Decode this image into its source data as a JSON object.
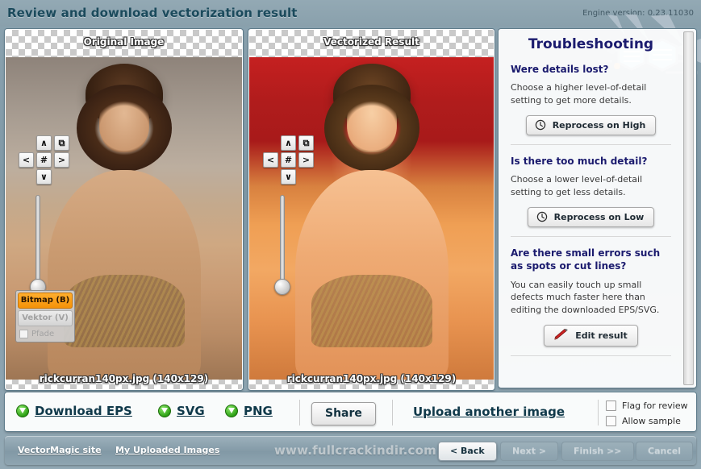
{
  "header": {
    "title": "Review and download vectorization result",
    "engine_version": "Engine version: 0.23.11030"
  },
  "panels": {
    "original": {
      "caption": "Original Image",
      "filename": "rickcurran140px.jpg (140x129)",
      "controls": {
        "up": "∧",
        "down": "∨",
        "left": "<",
        "right": ">",
        "center": "#",
        "fit": "⧉"
      },
      "modes": {
        "bitmap": "Bitmap (B)",
        "vektor": "Vektor (V)",
        "pfade": "Pfade"
      }
    },
    "result": {
      "caption": "Vectorized Result",
      "filename": "rickcurran140px.jpg (140x129)",
      "controls": {
        "up": "∧",
        "down": "∨",
        "left": "<",
        "right": ">",
        "center": "#",
        "fit": "⧉"
      }
    }
  },
  "troubleshooting": {
    "title": "Troubleshooting",
    "sections": [
      {
        "question": "Were details lost?",
        "body": "Choose a higher level-of-detail setting to get more details.",
        "button": "Reprocess on High",
        "icon": "clock-icon"
      },
      {
        "question": "Is there too much detail?",
        "body": "Choose a lower level-of-detail setting to get less details.",
        "button": "Reprocess on Low",
        "icon": "clock-icon"
      },
      {
        "question": "Are there small errors such as spots or cut lines?",
        "body": "You can easily touch up small defects much faster here than editing the downloaded EPS/SVG.",
        "button": "Edit result",
        "icon": "pencil-icon"
      }
    ]
  },
  "action_bar": {
    "downloads": [
      {
        "label": "Download EPS"
      },
      {
        "label": "SVG"
      },
      {
        "label": "PNG"
      }
    ],
    "share": "Share",
    "upload_another": "Upload another image",
    "checkboxes": [
      {
        "label": "Flag for review",
        "checked": false
      },
      {
        "label": "Allow sample",
        "checked": false
      }
    ]
  },
  "footer": {
    "links": [
      {
        "label": "VectorMagic site"
      },
      {
        "label": "My Uploaded Images"
      }
    ],
    "watermark": "www.fullcrackindir.com",
    "nav": [
      {
        "label": "< Back",
        "enabled": true
      },
      {
        "label": "Next >",
        "enabled": false
      },
      {
        "label": "Finish >>",
        "enabled": false
      },
      {
        "label": "Cancel",
        "enabled": false
      }
    ]
  },
  "colors": {
    "accent_orange": "#f59208",
    "link_dark": "#10394a",
    "heading_navy": "#1b1b6e"
  }
}
